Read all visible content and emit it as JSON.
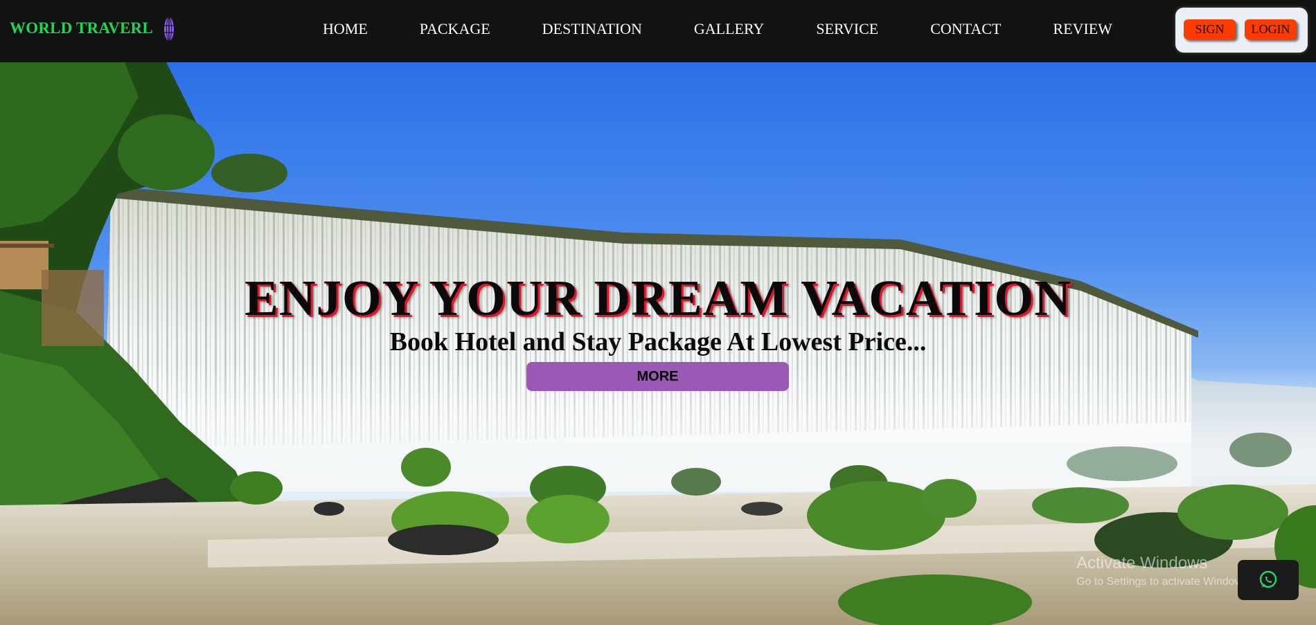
{
  "brand": {
    "name": "WORLD TRAVERL",
    "icon": "globe-icon",
    "color": "#1ed94f"
  },
  "nav": {
    "links": [
      "HOME",
      "PACKAGE",
      "DESTINATION",
      "GALLERY",
      "SERVICE",
      "CONTACT",
      "REVIEW"
    ]
  },
  "auth": {
    "sign_label": "SIGN",
    "login_label": "LOGIN",
    "button_color": "#ff3c00"
  },
  "hero": {
    "title": "ENJOY YOUR DREAM VACATION",
    "subtitle": "Book Hotel and Stay Package At Lowest Price...",
    "more_label": "MORE",
    "accent": "#9b59b6",
    "background": "waterfall-photo"
  },
  "overlay": {
    "activate_title": "Activate Windows",
    "activate_sub": "Go to Settings to activate Windows.",
    "whatsapp_icon": "whatsapp-icon"
  }
}
